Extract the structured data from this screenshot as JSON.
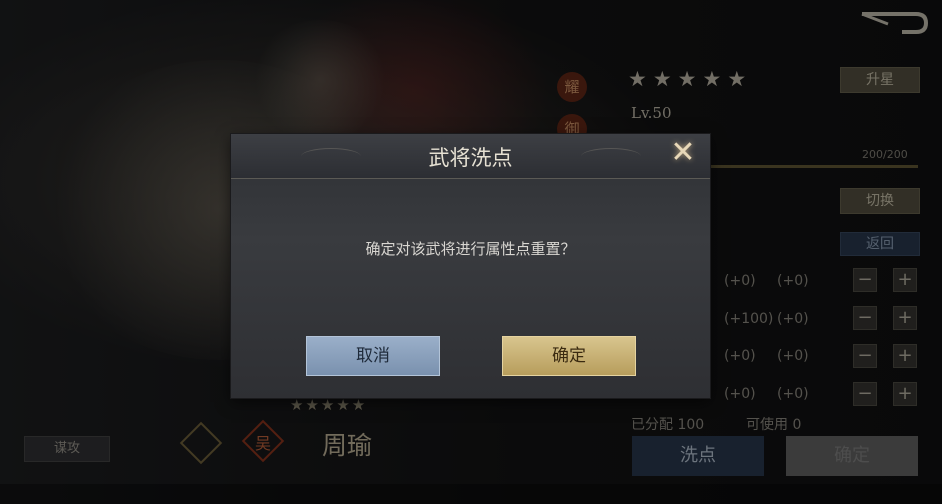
{
  "top": {
    "back_icon": "return-arrow-icon"
  },
  "hero": {
    "name": "周瑜",
    "strategy_label": "谋攻",
    "badge_1": "耀",
    "badge_2": "御",
    "stars": "★★★★★",
    "tag_char": "吴"
  },
  "stats_panel": {
    "stars": [
      "★",
      "★",
      "★",
      "★",
      "★"
    ],
    "level": "Lv.50",
    "upgrade_label": "升星",
    "exp_text": "200/200",
    "switch_label": "切换",
    "back_label": "返回",
    "rows": [
      {
        "a": "(+0)",
        "b": "(+0)"
      },
      {
        "a": "(+100)",
        "b": "(+0)"
      },
      {
        "a": "(+0)",
        "b": "(+0)"
      },
      {
        "a": "(+0)",
        "b": "(+0)"
      }
    ],
    "minus": "−",
    "plus": "+",
    "allocated": "已分配 100",
    "available": "可使用 0",
    "wash_label": "洗点",
    "confirm_label": "确定"
  },
  "dialog": {
    "title": "武将洗点",
    "message": "确定对该武将进行属性点重置？",
    "cancel_label": "取消",
    "ok_label": "确定",
    "close_icon": "close-x-icon"
  }
}
